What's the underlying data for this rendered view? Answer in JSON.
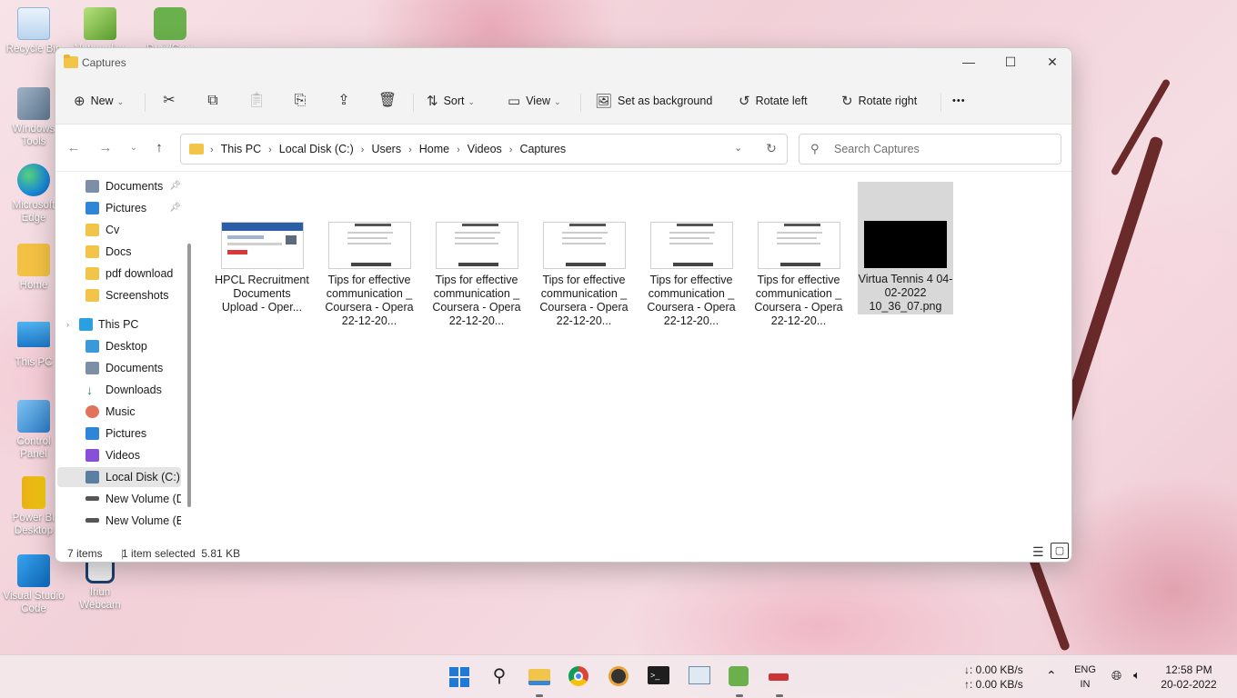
{
  "desktop": {
    "icons": [
      {
        "label": "Recycle Bin"
      },
      {
        "label": "Notepad++"
      },
      {
        "label": "DroidCam"
      },
      {
        "label": "Windows Tools"
      },
      {
        "label": "Microsoft Edge"
      },
      {
        "label": "Home"
      },
      {
        "label": "This PC"
      },
      {
        "label": "Control Panel"
      },
      {
        "label": "Power BI Desktop"
      },
      {
        "label": "Visual Studio Code"
      },
      {
        "label": "Iriun Webcam"
      }
    ]
  },
  "window": {
    "title": "Captures",
    "controls": {
      "minimize": "—",
      "maximize": "☐",
      "close": "✕"
    }
  },
  "toolbar": {
    "new_label": "New",
    "sort_label": "Sort",
    "view_label": "View",
    "set_background_label": "Set as background",
    "rotate_left_label": "Rotate left",
    "rotate_right_label": "Rotate right",
    "more_label": "•••"
  },
  "address": {
    "crumbs": [
      "This PC",
      "Local Disk (C:)",
      "Users",
      "Home",
      "Videos",
      "Captures"
    ]
  },
  "search": {
    "placeholder": "Search Captures"
  },
  "sidebar": {
    "items": [
      {
        "label": "Documents",
        "pinned": true
      },
      {
        "label": "Pictures",
        "pinned": true
      },
      {
        "label": "Cv"
      },
      {
        "label": "Docs"
      },
      {
        "label": "pdf download"
      },
      {
        "label": "Screenshots"
      },
      {
        "label": "This PC"
      },
      {
        "label": "Desktop"
      },
      {
        "label": "Documents"
      },
      {
        "label": "Downloads"
      },
      {
        "label": "Music"
      },
      {
        "label": "Pictures"
      },
      {
        "label": "Videos"
      },
      {
        "label": "Local Disk (C:)",
        "selected": true
      },
      {
        "label": "New Volume (D:"
      },
      {
        "label": "New Volume (E:"
      }
    ]
  },
  "files": [
    {
      "name": "HPCL Recruitment Documents Upload - Oper..."
    },
    {
      "name": "Tips for effective communication _ Coursera - Opera 22-12-20..."
    },
    {
      "name": "Tips for effective communication _ Coursera - Opera 22-12-20..."
    },
    {
      "name": "Tips for effective communication _ Coursera - Opera 22-12-20..."
    },
    {
      "name": "Tips for effective communication _ Coursera - Opera 22-12-20..."
    },
    {
      "name": "Tips for effective communication _ Coursera - Opera 22-12-20..."
    },
    {
      "name": "Virtua Tennis 4 04-02-2022 10_36_07.png",
      "selected": true
    }
  ],
  "status": {
    "items_count": "7 items",
    "selection": "1 item selected  5.81 KB"
  },
  "taskbar": {
    "net_down": "↓: 0.00 KB/s",
    "net_up": "↑: 0.00 KB/s",
    "lang_1": "ENG",
    "lang_2": "IN",
    "time": "12:58 PM",
    "date": "20-02-2022"
  }
}
